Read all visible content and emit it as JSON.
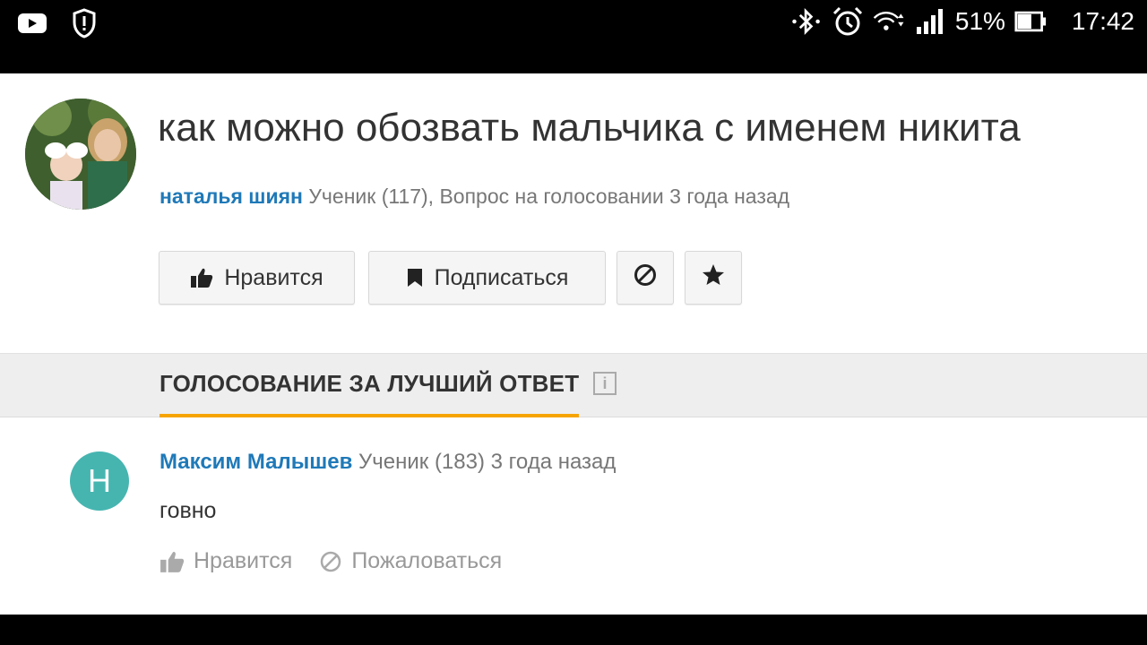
{
  "status_bar": {
    "battery": "51%",
    "time": "17:42",
    "left_icons": [
      "youtube-icon",
      "alert-shield-icon"
    ],
    "right_icons": [
      "bluetooth-icon",
      "alarm-icon",
      "wifi-icon",
      "signal-icon",
      "battery-icon"
    ]
  },
  "question": {
    "title": "как можно обозвать мальчика с именем никита",
    "author": "наталья шиян",
    "meta": "Ученик (117), Вопрос на голосовании 3 года назад"
  },
  "actions": {
    "like_label": "Нравится",
    "subscribe_label": "Подписаться"
  },
  "voting": {
    "title": "ГОЛОСОВАНИЕ ЗА ЛУЧШИЙ ОТВЕТ",
    "accent": "#f6a400"
  },
  "answer": {
    "avatar_letter": "Н",
    "author": "Максим Малышев",
    "meta": "Ученик (183) 3 года назад",
    "text": "говно",
    "like_label": "Нравится",
    "report_label": "Пожаловаться"
  },
  "colors": {
    "link": "#1f79b8",
    "avatar_bg": "#46b5b0"
  }
}
